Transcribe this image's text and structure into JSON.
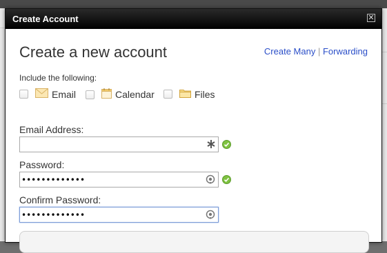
{
  "window": {
    "title": "Create Account",
    "close_glyph": "✕"
  },
  "heading": "Create a new account",
  "links": {
    "create_many": "Create Many",
    "separator": "|",
    "forwarding": "Forwarding"
  },
  "include": {
    "label": "Include the following:",
    "options": [
      {
        "label": "Email",
        "icon": "envelope-icon",
        "checked": false
      },
      {
        "label": "Calendar",
        "icon": "calendar-icon",
        "checked": false
      },
      {
        "label": "Files",
        "icon": "folder-icon",
        "checked": false
      }
    ]
  },
  "form": {
    "email": {
      "label": "Email Address:",
      "value": "",
      "status": "valid"
    },
    "password": {
      "label": "Password:",
      "value": "•••••••••••••",
      "status": "valid"
    },
    "confirm": {
      "label": "Confirm Password:",
      "value": "•••••••••••••"
    }
  },
  "colors": {
    "link": "#2a4ec8",
    "valid": "#7fc241",
    "titlebar": "#000000"
  }
}
